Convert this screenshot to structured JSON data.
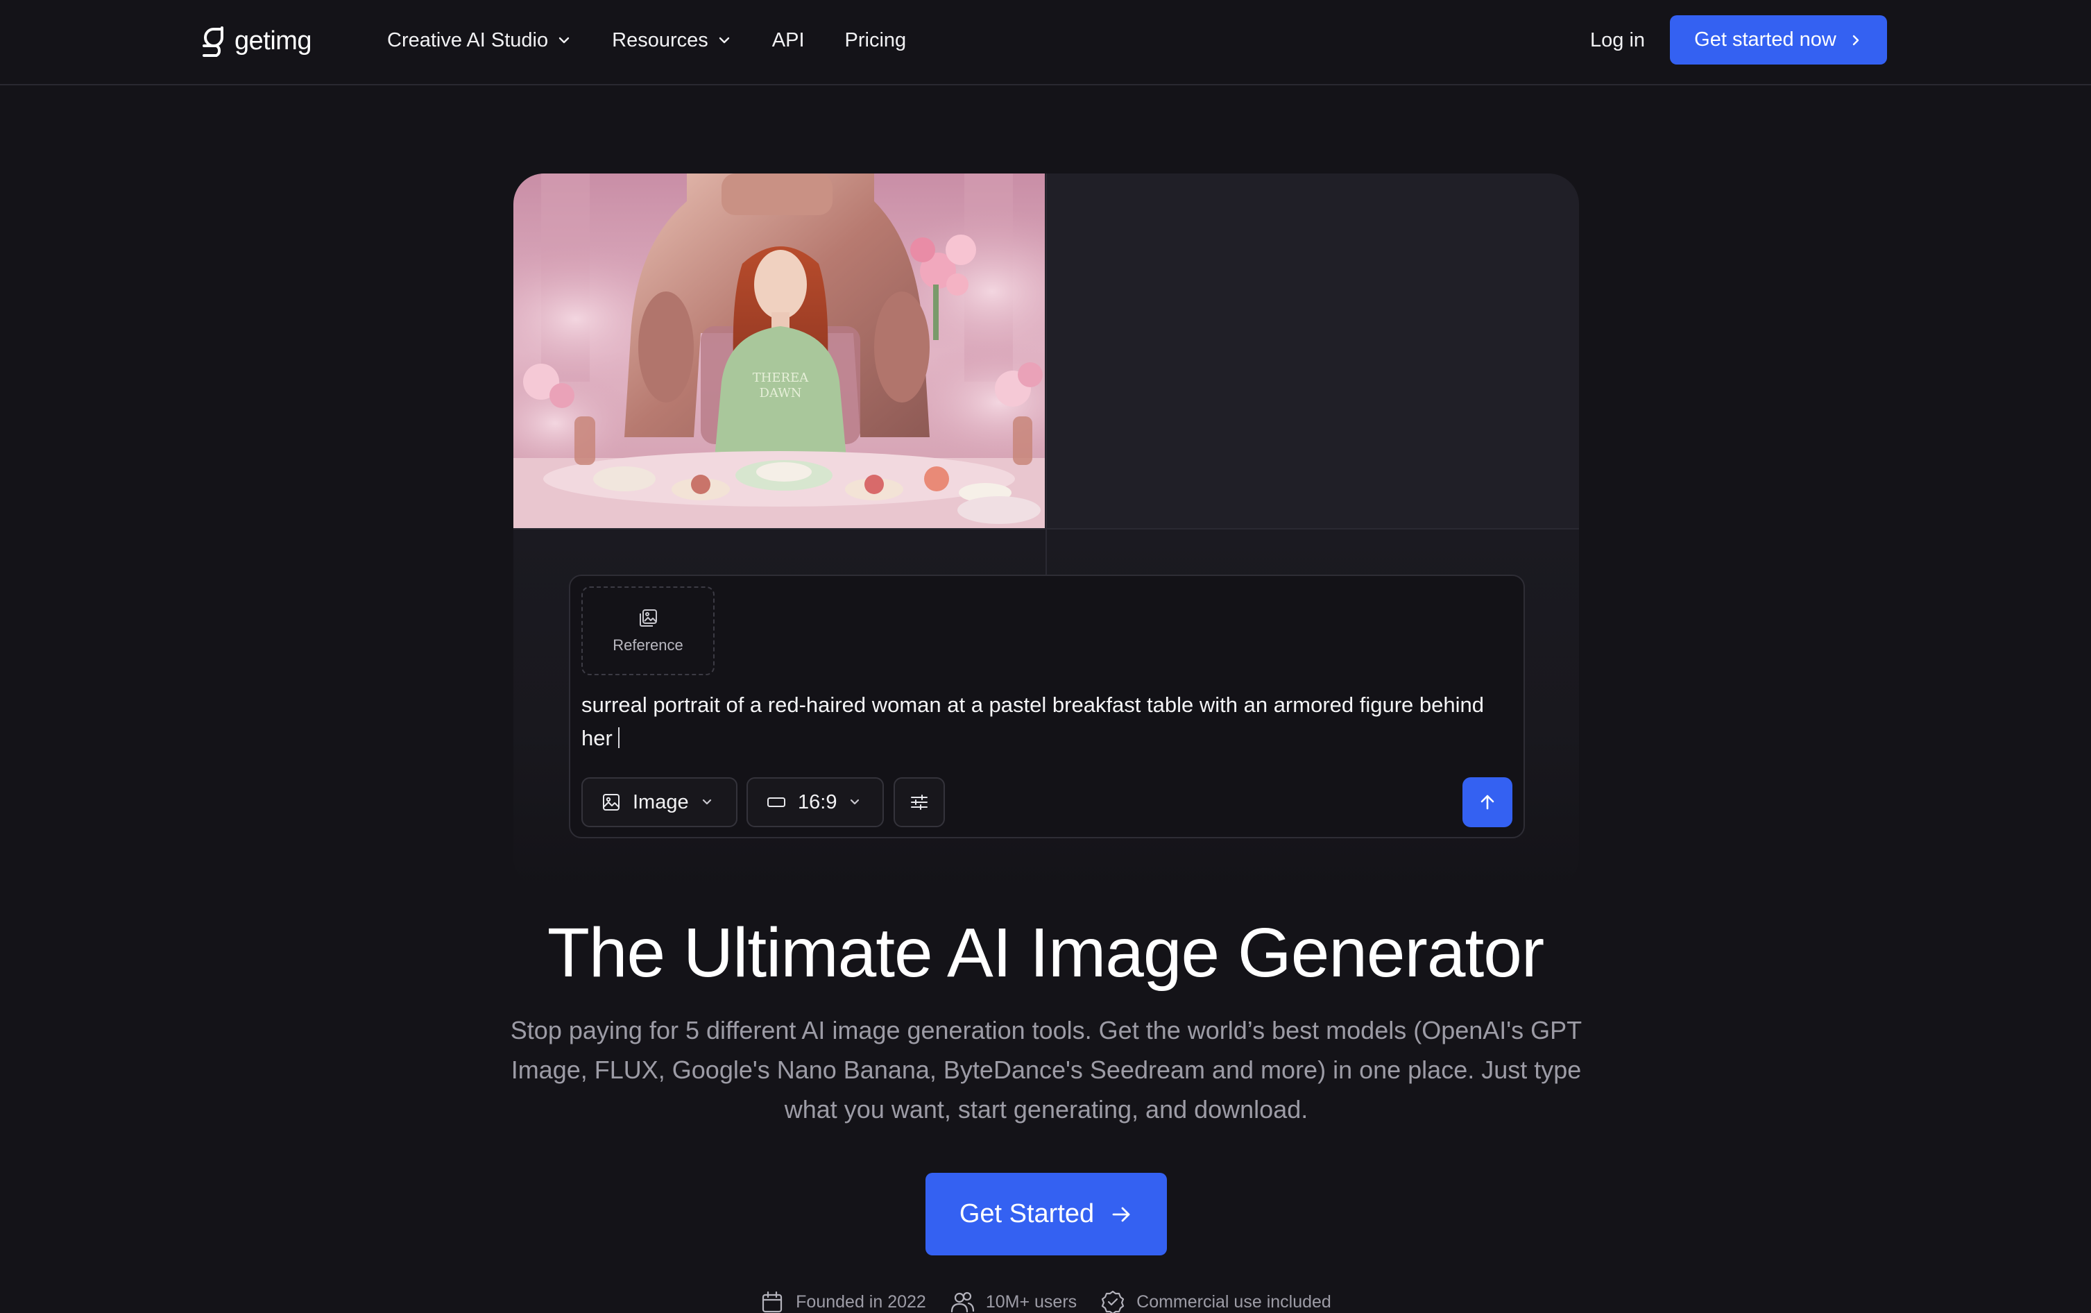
{
  "brand": {
    "name": "getimg",
    "logo_icon": "getimg-logo-icon"
  },
  "nav": {
    "items": [
      {
        "label": "Creative AI Studio",
        "has_dropdown": true
      },
      {
        "label": "Resources",
        "has_dropdown": true
      },
      {
        "label": "API",
        "has_dropdown": false
      },
      {
        "label": "Pricing",
        "has_dropdown": false
      }
    ],
    "login_label": "Log in",
    "cta_label": "Get started now"
  },
  "prompt_box": {
    "reference_label": "Reference",
    "prompt_text": "surreal portrait of a red-haired woman at a pastel breakfast table with an armored figure behind her",
    "mode_value": "Image",
    "aspect_ratio_value": "16:9"
  },
  "hero": {
    "title": "The Ultimate AI Image Generator",
    "subtitle": "Stop paying for 5 different AI image generation tools. Get the world’s best models (OpenAI's GPT Image, FLUX, Google's Nano Banana, ByteDance's Seedream and more) in one place. Just type what you want, start generating, and download.",
    "cta_label": "Get Started"
  },
  "badges": [
    {
      "icon": "calendar-icon",
      "label": "Founded in 2022"
    },
    {
      "icon": "users-icon",
      "label": "10M+ users"
    },
    {
      "icon": "check-badge-icon",
      "label": "Commercial use included"
    }
  ],
  "colors": {
    "background": "#141318",
    "accent": "#3461f2",
    "muted_text": "#9d9ca6"
  }
}
